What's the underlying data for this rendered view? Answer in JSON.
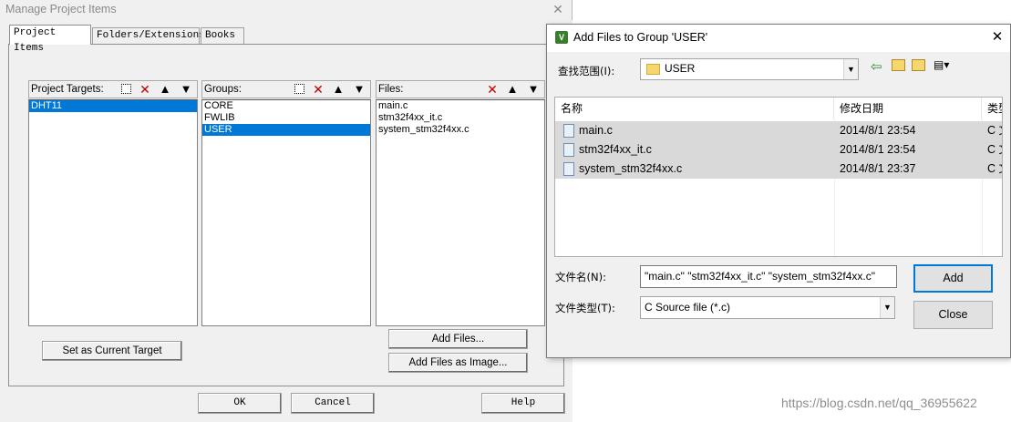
{
  "manage_dialog": {
    "title": "Manage Project Items",
    "close_glyph": "✕",
    "tabs": [
      "Project Items",
      "Folders/Extensions",
      "Books"
    ],
    "targets": {
      "header": "Project Targets:",
      "items": [
        "DHT11"
      ],
      "selected": 0
    },
    "groups": {
      "header": "Groups:",
      "items": [
        "CORE",
        "FWLIB",
        "USER"
      ],
      "selected": 2
    },
    "files": {
      "header": "Files:",
      "items": [
        "main.c",
        "stm32f4xx_it.c",
        "system_stm32f4xx.c"
      ]
    },
    "toolbar_glyphs": {
      "delete": "✕",
      "up": "🡅",
      "down": "🡇"
    },
    "buttons": {
      "set_current": "Set as Current Target",
      "add_files": "Add Files...",
      "add_image": "Add Files as Image...",
      "ok": "OK",
      "cancel": "Cancel",
      "help": "Help"
    }
  },
  "add_files_dialog": {
    "title": "Add Files to Group 'USER'",
    "app_icon_letter": "V",
    "close_glyph": "✕",
    "look_in_label": "查找范围(I):",
    "look_in_value": "USER",
    "nav_glyphs": {
      "back": "⇦",
      "up": "⬑",
      "new_folder": "✱",
      "view": "▤▾"
    },
    "columns": [
      "名称",
      "修改日期",
      "类型"
    ],
    "files": [
      {
        "name": "main.c",
        "date": "2014/8/1 23:54",
        "type": "C 文件"
      },
      {
        "name": "stm32f4xx_it.c",
        "date": "2014/8/1 23:54",
        "type": "C 文件"
      },
      {
        "name": "system_stm32f4xx.c",
        "date": "2014/8/1 23:37",
        "type": "C 文件"
      }
    ],
    "filename_label": "文件名(N):",
    "filename_value": "\"main.c\" \"stm32f4xx_it.c\" \"system_stm32f4xx.c\"",
    "filetype_label": "文件类型(T):",
    "filetype_value": "C Source file (*.c)",
    "add_label": "Add",
    "close_label": "Close",
    "scroll_left": "<",
    "scroll_right": ">",
    "sort_arrow": "^"
  },
  "watermark": "https://blog.csdn.net/qq_36955622",
  "colors": {
    "selection": "#0078d7",
    "dialog_bg": "#f0f0f0",
    "row_selected": "#d9d9d9"
  },
  "icons": [
    "new-item-icon",
    "delete-icon",
    "move-up-icon",
    "move-down-icon",
    "folder-icon",
    "c-file-icon",
    "back-icon",
    "up-folder-icon",
    "new-folder-icon",
    "view-menu-icon"
  ]
}
